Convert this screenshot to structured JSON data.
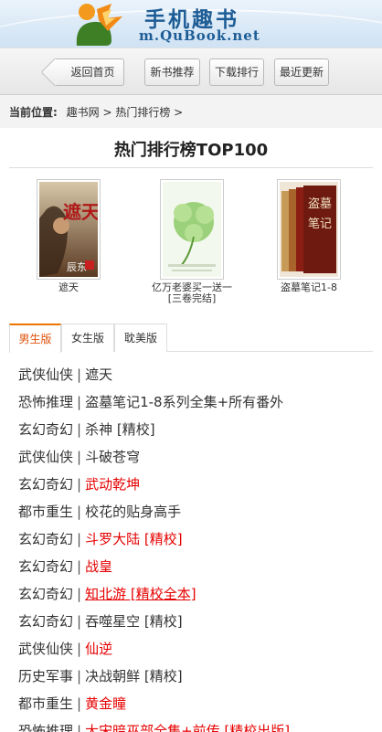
{
  "header": {
    "title": "手机趣书",
    "domain": "m.QuBook.net"
  },
  "nav": {
    "back": "返回首页",
    "items": [
      "新书推荐",
      "下载排行",
      "最近更新"
    ]
  },
  "breadcrumb": {
    "label": "当前位置:",
    "path": "趣书网 > 热门排行榜 >"
  },
  "page_title": "热门排行榜TOP100",
  "books": [
    {
      "title": "遮天",
      "cover_text": "遮天",
      "cover_author": "辰东",
      "cover_color": "#5a3a22"
    },
    {
      "title": "亿万老婆买一送一[三卷完结]",
      "cover_text": "",
      "cover_author": "",
      "cover_color": "#9bd17a"
    },
    {
      "title": "盗墓笔记1-8",
      "cover_text": "盗墓笔记",
      "cover_author": "",
      "cover_color": "#8b1e12"
    }
  ],
  "tabs": [
    "男生版",
    "女生版",
    "耽美版"
  ],
  "list": [
    {
      "category": "武侠仙侠",
      "name": "遮天",
      "red": false,
      "underline": false
    },
    {
      "category": "恐怖推理",
      "name": "盗墓笔记1-8系列全集+所有番外",
      "red": false,
      "underline": false
    },
    {
      "category": "玄幻奇幻",
      "name": "杀神 [精校]",
      "red": false,
      "underline": false
    },
    {
      "category": "武侠仙侠",
      "name": "斗破苍穹",
      "red": false,
      "underline": false
    },
    {
      "category": "玄幻奇幻",
      "name": "武动乾坤",
      "red": true,
      "underline": false
    },
    {
      "category": "都市重生",
      "name": "校花的贴身高手",
      "red": false,
      "underline": false
    },
    {
      "category": "玄幻奇幻",
      "name": "斗罗大陆 [精校]",
      "red": true,
      "underline": false
    },
    {
      "category": "玄幻奇幻",
      "name": "战皇",
      "red": true,
      "underline": false
    },
    {
      "category": "玄幻奇幻",
      "name": "知北游 [精校全本]",
      "red": true,
      "underline": true
    },
    {
      "category": "玄幻奇幻",
      "name": "吞噬星空 [精校]",
      "red": false,
      "underline": false
    },
    {
      "category": "武侠仙侠",
      "name": "仙逆",
      "red": true,
      "underline": false
    },
    {
      "category": "历史军事",
      "name": "决战朝鲜 [精校]",
      "red": false,
      "underline": false
    },
    {
      "category": "都市重生",
      "name": "黄金瞳",
      "red": true,
      "underline": false
    },
    {
      "category": "恐怖推理",
      "name": "大宋暗巫部全集+前传 [精校出版]",
      "red": true,
      "underline": true
    }
  ],
  "colors": {
    "brand": "#1e5d96",
    "active_tab": "#e0520a",
    "hot_link": "#e60000"
  }
}
